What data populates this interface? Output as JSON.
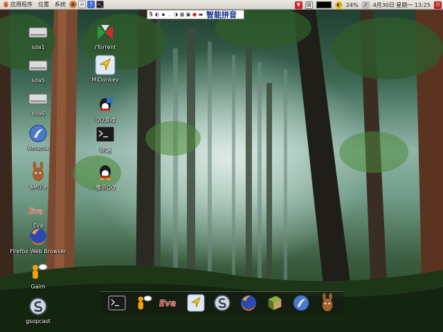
{
  "top_panel": {
    "menus": [
      {
        "label": "应用程序",
        "icon": "gnome-foot-icon"
      },
      {
        "label": "位置",
        "icon": ""
      },
      {
        "label": "系统",
        "icon": ""
      }
    ],
    "launchers": [
      "firefox-icon",
      "mail-icon",
      "help-icon",
      "terminal-icon"
    ],
    "tray": {
      "battery": "24%",
      "clock": "4月30日 星期一 13:25"
    }
  },
  "ime": {
    "label": "智能拼音"
  },
  "desktop_icons": [
    {
      "label": "sda1",
      "icon": "drive-icon"
    },
    {
      "label": "sda5",
      "icon": "drive-icon"
    },
    {
      "label": "sda6",
      "icon": "drive-icon"
    },
    {
      "label": "Amarok",
      "icon": "amarok-icon"
    },
    {
      "label": "aMule",
      "icon": "amule-icon"
    },
    {
      "label": "Eva",
      "icon": "eva-icon"
    },
    {
      "label": "Firefox Web Browser",
      "icon": "firefox-icon"
    },
    {
      "label": "Gaim",
      "icon": "gaim-icon"
    },
    {
      "label": "gsopcast",
      "icon": "gsopcast-icon"
    },
    {
      "label": "rTorrent",
      "icon": "torrent-icon"
    },
    {
      "label": "MlDonkey",
      "icon": "mldonkey-icon"
    },
    {
      "label": "QQ游戏",
      "icon": "qq-game-icon"
    },
    {
      "label": "终端",
      "icon": "terminal-icon"
    },
    {
      "label": "腾讯QQ",
      "icon": "qq-icon"
    }
  ],
  "dock": [
    "terminal-icon",
    "gaim-icon",
    "eva-icon",
    "mldonkey-icon",
    "gsopcast-icon",
    "firefox-icon",
    "book-icon",
    "amarok-icon",
    "amule-icon"
  ],
  "colors": {
    "panel_bg": "#e2e0da",
    "label_text": "#ffffff",
    "ime_text": "#0a2a8a"
  }
}
